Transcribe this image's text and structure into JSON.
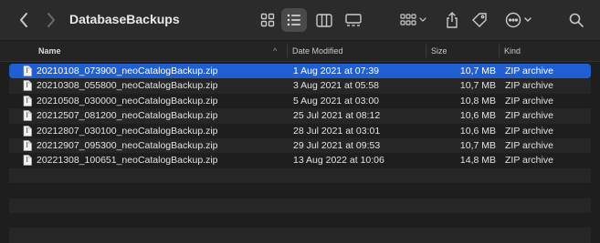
{
  "window": {
    "title": "DatabaseBackups"
  },
  "toolbar": {
    "back_icon": "chevron-left-icon",
    "forward_icon": "chevron-right-icon",
    "views": [
      "icon-view-icon",
      "list-view-icon",
      "column-view-icon",
      "gallery-view-icon"
    ],
    "active_view": "list-view-icon",
    "group_icon": "group-by-icon",
    "share_icon": "share-icon",
    "tag_icon": "tag-icon",
    "more_icon": "ellipsis-circle-icon",
    "search_icon": "search-icon"
  },
  "columns": {
    "name": "Name",
    "sort_indicator": "^",
    "date": "Date Modified",
    "size": "Size",
    "kind": "Kind"
  },
  "files": [
    {
      "name": "20210108_073900_neoCatalogBackup.zip",
      "date": "1 Aug 2021 at 07:39",
      "size": "10,7 MB",
      "kind": "ZIP archive",
      "selected": true
    },
    {
      "name": "20210308_055800_neoCatalogBackup.zip",
      "date": "3 Aug 2021 at 05:58",
      "size": "10,7 MB",
      "kind": "ZIP archive",
      "selected": false
    },
    {
      "name": "20210508_030000_neoCatalogBackup.zip",
      "date": "5 Aug 2021 at 03:00",
      "size": "10,8 MB",
      "kind": "ZIP archive",
      "selected": false
    },
    {
      "name": "20212507_081200_neoCatalogBackup.zip",
      "date": "25 Jul 2021 at 08:12",
      "size": "10,6 MB",
      "kind": "ZIP archive",
      "selected": false
    },
    {
      "name": "20212807_030100_neoCatalogBackup.zip",
      "date": "28 Jul 2021 at 03:01",
      "size": "10,6 MB",
      "kind": "ZIP archive",
      "selected": false
    },
    {
      "name": "20212907_095300_neoCatalogBackup.zip",
      "date": "29 Jul 2021 at 09:53",
      "size": "10,7 MB",
      "kind": "ZIP archive",
      "selected": false
    },
    {
      "name": "20221308_100651_neoCatalogBackup.zip",
      "date": "13 Aug 2022 at 10:06",
      "size": "14,8 MB",
      "kind": "ZIP archive",
      "selected": false
    }
  ],
  "colors": {
    "selection": "#1f5fd1",
    "background": "#1e1e1e",
    "toolbar": "#2b2b2b",
    "alt_row": "#262626"
  }
}
